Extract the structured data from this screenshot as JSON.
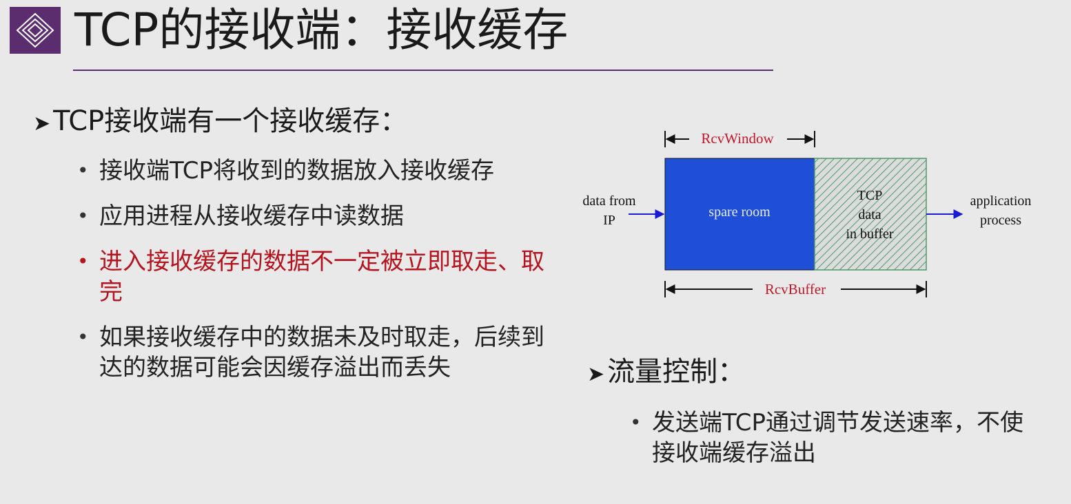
{
  "slide": {
    "title": "TCP的接收端：接收缓存",
    "section1": {
      "heading": "TCP接收端有一个接收缓存：",
      "bullets": [
        {
          "text": "接收端TCP将收到的数据放入接收缓存",
          "highlight": false
        },
        {
          "text": "应用进程从接收缓存中读数据",
          "highlight": false
        },
        {
          "text": "进入接收缓存的数据不一定被立即取走、取完",
          "highlight": true
        },
        {
          "text": "如果接收缓存中的数据未及时取走，后续到达的数据可能会因缓存溢出而丢失",
          "highlight": false
        }
      ]
    },
    "section2": {
      "heading": "流量控制：",
      "bullets": [
        {
          "text": "发送端TCP通过调节发送速率，不使接收端缓存溢出"
        }
      ]
    },
    "diagram": {
      "rcv_window_label": "RcvWindow",
      "rcv_buffer_label": "RcvBuffer",
      "spare_room_label": "spare room",
      "tcp_data_line1": "TCP",
      "tcp_data_line2": "data",
      "tcp_data_line3": "in buffer",
      "input_line1": "data from",
      "input_line2": "IP",
      "output_line1": "application",
      "output_line2": "process"
    },
    "bullet_symbol": "•",
    "heading_symbol": "➤"
  },
  "colors": {
    "accent": "#5b2d6e",
    "highlight_text": "#b5141f",
    "spare_room_fill": "#1f4fd6",
    "buffer_hatch": "#4c9a6b",
    "arrow_blue": "#1a1ad6",
    "label_red": "#c0182a"
  },
  "icons": {
    "logo": "concentric-diamond-logo-icon",
    "heading_marker": "arrowhead-icon"
  }
}
